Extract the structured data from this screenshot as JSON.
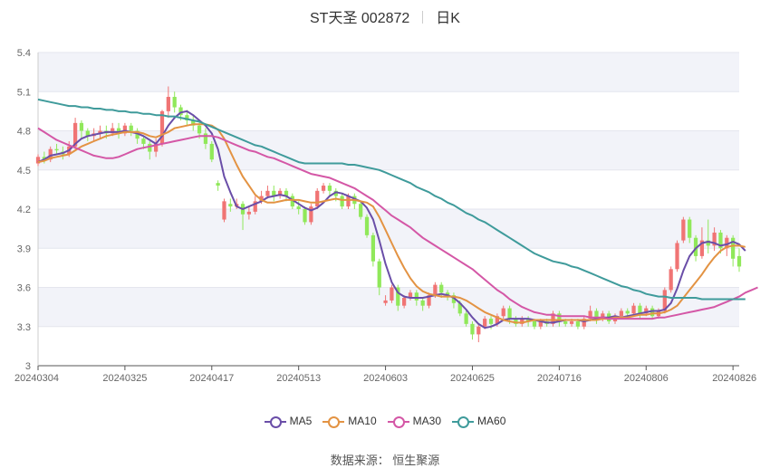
{
  "header": {
    "title": "ST天圣 002872",
    "period": "日K"
  },
  "footer": {
    "source": "数据来源： 恒生聚源"
  },
  "colors": {
    "up": "#f07474",
    "down": "#90e85a",
    "ma5": "#6a4ea8",
    "ma10": "#e39343",
    "ma30": "#d457a6",
    "ma60": "#3f9b9b",
    "band": "#f2f3f9",
    "axis": "#555555"
  },
  "chart_data": {
    "type": "candlestick",
    "title": "ST天圣 002872",
    "ylim": [
      3,
      5.4
    ],
    "yticks": [
      "5.4",
      "5.1",
      "4.8",
      "4.5",
      "4.2",
      "3.9",
      "3.6",
      "3.3",
      "3"
    ],
    "xticks": [
      "20240304",
      "20240325",
      "20240417",
      "20240513",
      "20240603",
      "20240625",
      "20240716",
      "20240806",
      "20240826"
    ],
    "xtick_index": [
      0,
      14,
      28,
      42,
      56,
      70,
      84,
      98,
      112
    ],
    "grid": true,
    "legend_position": "bottom",
    "candles": [
      [
        4.55,
        4.6,
        4.53,
        4.62
      ],
      [
        4.6,
        4.58,
        4.55,
        4.64
      ],
      [
        4.58,
        4.66,
        4.56,
        4.68
      ],
      [
        4.66,
        4.65,
        4.62,
        4.7
      ],
      [
        4.64,
        4.62,
        4.58,
        4.68
      ],
      [
        4.62,
        4.68,
        4.6,
        4.72
      ],
      [
        4.68,
        4.86,
        4.66,
        4.9
      ],
      [
        4.86,
        4.8,
        4.74,
        4.88
      ],
      [
        4.8,
        4.76,
        4.72,
        4.82
      ],
      [
        4.76,
        4.78,
        4.72,
        4.82
      ],
      [
        4.78,
        4.8,
        4.74,
        4.84
      ],
      [
        4.8,
        4.78,
        4.74,
        4.84
      ],
      [
        4.78,
        4.82,
        4.76,
        4.86
      ],
      [
        4.82,
        4.78,
        4.74,
        4.86
      ],
      [
        4.78,
        4.84,
        4.76,
        4.86
      ],
      [
        4.84,
        4.8,
        4.76,
        4.86
      ],
      [
        4.8,
        4.74,
        4.7,
        4.82
      ],
      [
        4.74,
        4.7,
        4.66,
        4.76
      ],
      [
        4.7,
        4.64,
        4.58,
        4.72
      ],
      [
        4.64,
        4.7,
        4.6,
        4.74
      ],
      [
        4.7,
        4.95,
        4.68,
        4.96
      ],
      [
        4.95,
        5.06,
        4.9,
        5.14
      ],
      [
        5.06,
        4.98,
        4.94,
        5.1
      ],
      [
        4.98,
        4.92,
        4.88,
        5.0
      ],
      [
        4.92,
        4.88,
        4.84,
        4.96
      ],
      [
        4.88,
        4.84,
        4.8,
        4.92
      ],
      [
        4.84,
        4.78,
        4.74,
        4.88
      ],
      [
        4.78,
        4.7,
        4.66,
        4.82
      ],
      [
        4.7,
        4.58,
        4.56,
        4.72
      ],
      [
        4.4,
        4.38,
        4.34,
        4.42
      ],
      [
        4.12,
        4.26,
        4.1,
        4.28
      ],
      [
        4.24,
        4.22,
        4.18,
        4.28
      ],
      [
        4.22,
        4.24,
        4.2,
        4.28
      ],
      [
        4.24,
        4.16,
        4.04,
        4.26
      ],
      [
        4.16,
        4.18,
        4.12,
        4.22
      ],
      [
        4.18,
        4.26,
        4.16,
        4.3
      ],
      [
        4.26,
        4.3,
        4.24,
        4.34
      ],
      [
        4.3,
        4.34,
        4.28,
        4.38
      ],
      [
        4.34,
        4.3,
        4.26,
        4.38
      ],
      [
        4.3,
        4.34,
        4.28,
        4.36
      ],
      [
        4.34,
        4.3,
        4.26,
        4.36
      ],
      [
        4.3,
        4.22,
        4.2,
        4.32
      ],
      [
        4.22,
        4.2,
        4.16,
        4.26
      ],
      [
        4.2,
        4.1,
        4.08,
        4.22
      ],
      [
        4.1,
        4.22,
        4.08,
        4.24
      ],
      [
        4.22,
        4.34,
        4.2,
        4.36
      ],
      [
        4.34,
        4.38,
        4.32,
        4.4
      ],
      [
        4.38,
        4.34,
        4.3,
        4.4
      ],
      [
        4.34,
        4.3,
        4.26,
        4.36
      ],
      [
        4.3,
        4.22,
        4.2,
        4.32
      ],
      [
        4.22,
        4.3,
        4.2,
        4.32
      ],
      [
        4.3,
        4.24,
        4.2,
        4.32
      ],
      [
        4.24,
        4.14,
        4.12,
        4.26
      ],
      [
        4.14,
        4.0,
        3.98,
        4.16
      ],
      [
        4.0,
        3.8,
        3.76,
        4.02
      ],
      [
        3.8,
        3.6,
        3.54,
        3.82
      ],
      [
        3.48,
        3.5,
        3.46,
        3.54
      ],
      [
        3.5,
        3.6,
        3.48,
        3.62
      ],
      [
        3.6,
        3.46,
        3.42,
        3.62
      ],
      [
        3.46,
        3.52,
        3.44,
        3.54
      ],
      [
        3.52,
        3.56,
        3.5,
        3.58
      ],
      [
        3.56,
        3.5,
        3.46,
        3.58
      ],
      [
        3.5,
        3.46,
        3.42,
        3.52
      ],
      [
        3.46,
        3.54,
        3.44,
        3.56
      ],
      [
        3.54,
        3.62,
        3.52,
        3.64
      ],
      [
        3.62,
        3.56,
        3.52,
        3.64
      ],
      [
        3.56,
        3.54,
        3.5,
        3.58
      ],
      [
        3.54,
        3.48,
        3.44,
        3.56
      ],
      [
        3.48,
        3.4,
        3.38,
        3.5
      ],
      [
        3.4,
        3.32,
        3.3,
        3.42
      ],
      [
        3.32,
        3.24,
        3.2,
        3.34
      ],
      [
        3.24,
        3.3,
        3.18,
        3.32
      ],
      [
        3.3,
        3.36,
        3.28,
        3.38
      ],
      [
        3.36,
        3.32,
        3.28,
        3.38
      ],
      [
        3.32,
        3.38,
        3.3,
        3.4
      ],
      [
        3.38,
        3.44,
        3.36,
        3.46
      ],
      [
        3.44,
        3.36,
        3.32,
        3.46
      ],
      [
        3.36,
        3.32,
        3.3,
        3.38
      ],
      [
        3.32,
        3.36,
        3.3,
        3.38
      ],
      [
        3.36,
        3.34,
        3.3,
        3.38
      ],
      [
        3.34,
        3.3,
        3.28,
        3.36
      ],
      [
        3.3,
        3.34,
        3.28,
        3.36
      ],
      [
        3.34,
        3.32,
        3.3,
        3.36
      ],
      [
        3.32,
        3.4,
        3.3,
        3.42
      ],
      [
        3.4,
        3.34,
        3.3,
        3.42
      ],
      [
        3.34,
        3.32,
        3.3,
        3.36
      ],
      [
        3.32,
        3.34,
        3.3,
        3.36
      ],
      [
        3.34,
        3.3,
        3.28,
        3.36
      ],
      [
        3.3,
        3.36,
        3.28,
        3.38
      ],
      [
        3.36,
        3.42,
        3.34,
        3.46
      ],
      [
        3.42,
        3.36,
        3.32,
        3.44
      ],
      [
        3.36,
        3.4,
        3.34,
        3.42
      ],
      [
        3.4,
        3.34,
        3.32,
        3.42
      ],
      [
        3.34,
        3.38,
        3.32,
        3.4
      ],
      [
        3.38,
        3.42,
        3.36,
        3.44
      ],
      [
        3.42,
        3.4,
        3.36,
        3.44
      ],
      [
        3.4,
        3.46,
        3.38,
        3.48
      ],
      [
        3.46,
        3.4,
        3.36,
        3.48
      ],
      [
        3.4,
        3.44,
        3.38,
        3.46
      ],
      [
        3.44,
        3.38,
        3.36,
        3.46
      ],
      [
        3.38,
        3.42,
        3.36,
        3.44
      ],
      [
        3.42,
        3.58,
        3.4,
        3.6
      ],
      [
        3.58,
        3.74,
        3.56,
        3.76
      ],
      [
        3.74,
        3.94,
        3.72,
        3.96
      ],
      [
        3.96,
        4.12,
        3.94,
        4.14
      ],
      [
        4.12,
        3.98,
        3.94,
        4.14
      ],
      [
        3.98,
        3.84,
        3.8,
        4.0
      ],
      [
        3.84,
        3.96,
        3.82,
        4.06
      ],
      [
        3.96,
        3.92,
        3.86,
        4.12
      ],
      [
        3.92,
        4.02,
        3.88,
        4.06
      ],
      [
        4.02,
        3.9,
        3.86,
        4.04
      ],
      [
        3.9,
        3.98,
        3.84,
        4.0
      ],
      [
        3.98,
        3.82,
        3.76,
        4.0
      ],
      [
        3.84,
        3.76,
        3.72,
        3.9
      ]
    ],
    "series": [
      {
        "name": "MA5",
        "values": [
          4.56,
          4.58,
          4.61,
          4.62,
          4.63,
          4.65,
          4.7,
          4.74,
          4.76,
          4.77,
          4.78,
          4.79,
          4.79,
          4.79,
          4.8,
          4.79,
          4.78,
          4.76,
          4.73,
          4.7,
          4.76,
          4.84,
          4.9,
          4.94,
          4.95,
          4.92,
          4.88,
          4.84,
          4.78,
          4.66,
          4.45,
          4.33,
          4.22,
          4.2,
          4.22,
          4.24,
          4.26,
          4.29,
          4.3,
          4.31,
          4.3,
          4.27,
          4.24,
          4.21,
          4.19,
          4.21,
          4.25,
          4.3,
          4.33,
          4.32,
          4.3,
          4.28,
          4.26,
          4.21,
          4.12,
          3.96,
          3.78,
          3.64,
          3.56,
          3.53,
          3.52,
          3.52,
          3.52,
          3.53,
          3.54,
          3.55,
          3.54,
          3.52,
          3.48,
          3.43,
          3.37,
          3.32,
          3.29,
          3.3,
          3.32,
          3.35,
          3.36,
          3.36,
          3.36,
          3.36,
          3.35,
          3.34,
          3.33,
          3.33,
          3.34,
          3.35,
          3.35,
          3.35,
          3.34,
          3.35,
          3.36,
          3.37,
          3.37,
          3.38,
          3.37,
          3.38,
          3.39,
          3.4,
          3.41,
          3.42,
          3.42,
          3.43,
          3.48,
          3.59,
          3.73,
          3.84,
          3.9,
          3.94,
          3.95,
          3.94,
          3.92,
          3.93,
          3.95,
          3.93,
          3.88
        ]
      },
      {
        "name": "MA10",
        "values": [
          4.56,
          4.57,
          4.59,
          4.6,
          4.61,
          4.62,
          4.65,
          4.68,
          4.7,
          4.72,
          4.74,
          4.76,
          4.77,
          4.78,
          4.79,
          4.79,
          4.79,
          4.78,
          4.76,
          4.75,
          4.77,
          4.79,
          4.82,
          4.83,
          4.84,
          4.85,
          4.85,
          4.85,
          4.84,
          4.81,
          4.74,
          4.64,
          4.54,
          4.45,
          4.38,
          4.31,
          4.27,
          4.25,
          4.25,
          4.26,
          4.27,
          4.27,
          4.27,
          4.26,
          4.25,
          4.25,
          4.26,
          4.27,
          4.28,
          4.27,
          4.27,
          4.27,
          4.26,
          4.25,
          4.22,
          4.14,
          4.04,
          3.94,
          3.84,
          3.75,
          3.67,
          3.61,
          3.57,
          3.55,
          3.54,
          3.53,
          3.53,
          3.53,
          3.52,
          3.5,
          3.47,
          3.44,
          3.41,
          3.39,
          3.37,
          3.35,
          3.34,
          3.33,
          3.33,
          3.34,
          3.35,
          3.35,
          3.35,
          3.35,
          3.35,
          3.35,
          3.35,
          3.35,
          3.35,
          3.35,
          3.35,
          3.36,
          3.36,
          3.37,
          3.37,
          3.37,
          3.38,
          3.39,
          3.39,
          3.4,
          3.4,
          3.41,
          3.43,
          3.46,
          3.52,
          3.58,
          3.64,
          3.7,
          3.77,
          3.83,
          3.88,
          3.91,
          3.92,
          3.92,
          3.91
        ]
      },
      {
        "name": "MA30",
        "values": [
          4.82,
          4.79,
          4.76,
          4.73,
          4.71,
          4.69,
          4.67,
          4.65,
          4.63,
          4.61,
          4.6,
          4.59,
          4.59,
          4.6,
          4.62,
          4.64,
          4.66,
          4.67,
          4.68,
          4.69,
          4.7,
          4.71,
          4.72,
          4.73,
          4.74,
          4.75,
          4.76,
          4.76,
          4.76,
          4.75,
          4.73,
          4.71,
          4.69,
          4.67,
          4.65,
          4.64,
          4.62,
          4.6,
          4.59,
          4.57,
          4.55,
          4.53,
          4.51,
          4.49,
          4.47,
          4.46,
          4.45,
          4.44,
          4.42,
          4.4,
          4.38,
          4.36,
          4.33,
          4.3,
          4.27,
          4.23,
          4.19,
          4.15,
          4.12,
          4.09,
          4.06,
          4.02,
          3.98,
          3.95,
          3.92,
          3.89,
          3.86,
          3.83,
          3.8,
          3.77,
          3.74,
          3.7,
          3.66,
          3.62,
          3.58,
          3.55,
          3.51,
          3.48,
          3.45,
          3.43,
          3.41,
          3.4,
          3.39,
          3.39,
          3.38,
          3.38,
          3.38,
          3.38,
          3.38,
          3.37,
          3.37,
          3.37,
          3.36,
          3.36,
          3.36,
          3.36,
          3.36,
          3.36,
          3.36,
          3.36,
          3.37,
          3.37,
          3.38,
          3.39,
          3.4,
          3.41,
          3.42,
          3.43,
          3.44,
          3.45,
          3.47,
          3.49,
          3.51,
          3.53,
          3.56,
          3.58,
          3.6
        ]
      },
      {
        "name": "MA60",
        "values": [
          5.04,
          5.03,
          5.02,
          5.01,
          5.0,
          4.99,
          4.99,
          4.98,
          4.98,
          4.97,
          4.97,
          4.96,
          4.96,
          4.95,
          4.95,
          4.94,
          4.94,
          4.93,
          4.93,
          4.92,
          4.92,
          4.91,
          4.91,
          4.9,
          4.89,
          4.88,
          4.87,
          4.85,
          4.83,
          4.81,
          4.79,
          4.77,
          4.75,
          4.73,
          4.71,
          4.69,
          4.68,
          4.66,
          4.64,
          4.62,
          4.6,
          4.58,
          4.56,
          4.55,
          4.55,
          4.55,
          4.55,
          4.55,
          4.55,
          4.55,
          4.54,
          4.54,
          4.53,
          4.52,
          4.51,
          4.5,
          4.48,
          4.46,
          4.44,
          4.42,
          4.4,
          4.37,
          4.35,
          4.33,
          4.3,
          4.28,
          4.25,
          4.23,
          4.2,
          4.17,
          4.15,
          4.12,
          4.1,
          4.07,
          4.04,
          4.01,
          3.98,
          3.95,
          3.92,
          3.89,
          3.86,
          3.84,
          3.82,
          3.8,
          3.79,
          3.78,
          3.76,
          3.75,
          3.73,
          3.71,
          3.69,
          3.67,
          3.65,
          3.63,
          3.61,
          3.6,
          3.58,
          3.57,
          3.55,
          3.54,
          3.53,
          3.53,
          3.52,
          3.52,
          3.52,
          3.52,
          3.52,
          3.51,
          3.51,
          3.51,
          3.51,
          3.51,
          3.51,
          3.51,
          3.51
        ]
      }
    ]
  }
}
